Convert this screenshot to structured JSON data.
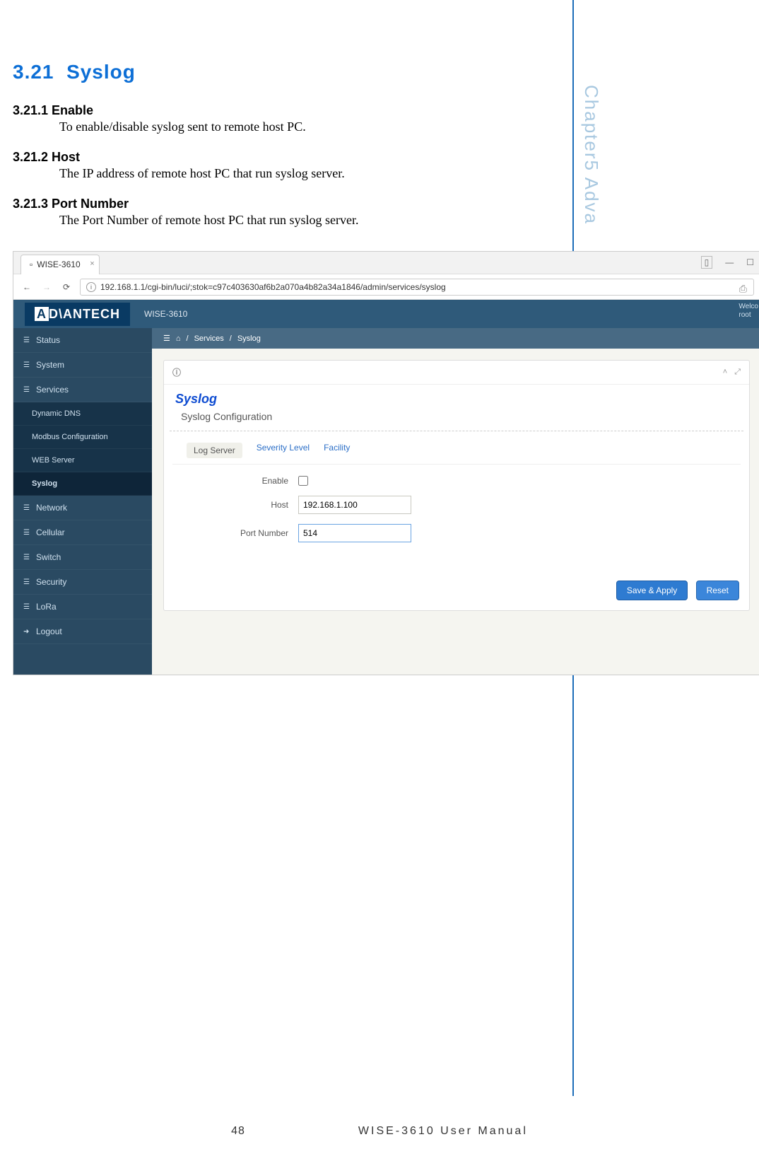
{
  "doc": {
    "section_no": "3.21",
    "section_title": "Syslog",
    "s1_no": "3.21.1 Enable",
    "s1_body": "To enable/disable syslog sent to remote host PC.",
    "s2_no": "3.21.2 Host",
    "s2_body": "The IP address of remote host PC that run syslog server.",
    "s3_no": "3.21.3 Port Number",
    "s3_body": "The Port Number of remote host PC that run syslog server.",
    "page_no": "48",
    "manual": "WISE-3610  User  Manual",
    "side": "Chapter5   Adva"
  },
  "shot": {
    "tab_title": "WISE-3610",
    "url": "192.168.1.1/cgi-bin/luci/;stok=c97c403630af6b2a070a4b82a34a1846/admin/services/syslog",
    "brand": "ADVANTECH",
    "device": "WISE-3610",
    "welcome_l1": "Welco",
    "welcome_l2": "root",
    "crumb_services": "Services",
    "crumb_syslog": "Syslog",
    "panel_title": "Syslog",
    "panel_sub": "Syslog Configuration",
    "tabs": {
      "t1": "Log Server",
      "t2": "Severity Level",
      "t3": "Facility"
    },
    "labels": {
      "enable": "Enable",
      "host": "Host",
      "port": "Port Number"
    },
    "values": {
      "host": "192.168.1.100",
      "port": "514"
    },
    "buttons": {
      "save": "Save & Apply",
      "reset": "Reset"
    },
    "sidebar": {
      "status": "Status",
      "system": "System",
      "services": "Services",
      "ddns": "Dynamic DNS",
      "modbus": "Modbus Configuration",
      "web": "WEB Server",
      "syslog": "Syslog",
      "network": "Network",
      "cellular": "Cellular",
      "switch": "Switch",
      "security": "Security",
      "lora": "LoRa",
      "logout": "Logout"
    }
  }
}
